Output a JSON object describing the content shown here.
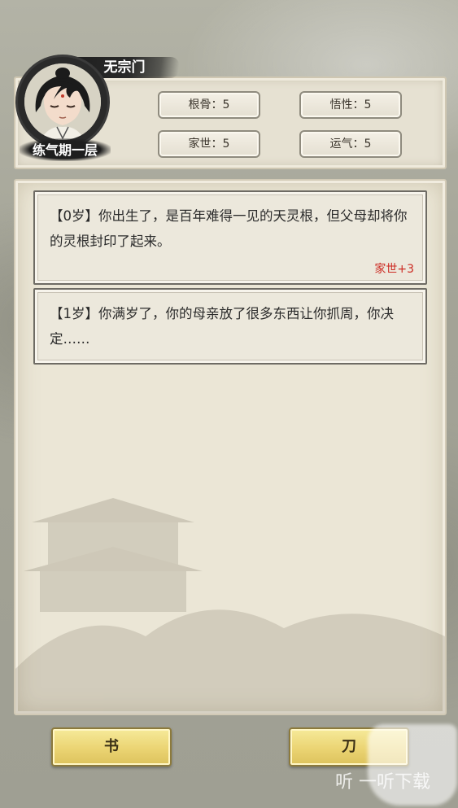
{
  "player": {
    "sect": "无宗门",
    "realm": "练气期一层"
  },
  "stats": [
    {
      "label": "根骨：5"
    },
    {
      "label": "悟性：5"
    },
    {
      "label": "家世：5"
    },
    {
      "label": "运气：5"
    }
  ],
  "events": [
    {
      "text": "【0岁】你出生了，是百年难得一见的天灵根，但父母却将你的灵根封印了起来。",
      "effect": "家世+3"
    },
    {
      "text": "【1岁】你满岁了，你的母亲放了很多东西让你抓周，你决定……",
      "effect": ""
    }
  ],
  "choices": {
    "left": "书",
    "right": "刀"
  },
  "watermark": {
    "text": "听 一听下载"
  },
  "colors": {
    "effect_red": "#cc2a22",
    "button_gold": "#ebd473"
  }
}
